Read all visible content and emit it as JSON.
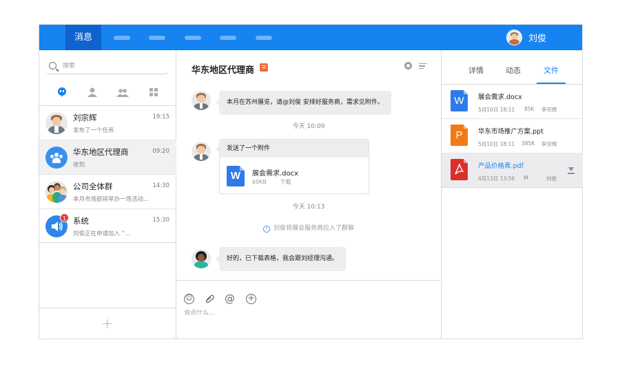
{
  "topbar": {
    "active_tab": "消息",
    "user_name": "刘俊",
    "bg_color": "#1783f0"
  },
  "sidebar": {
    "search_placeholder": "搜索",
    "filters": [
      "chat-icon",
      "person-icon",
      "group-icon",
      "apps-icon"
    ],
    "conversations": [
      {
        "title": "刘宗辉",
        "time": "19:15",
        "preview": "发布了一个任务"
      },
      {
        "title": "华东地区代理商",
        "time": "09:20",
        "preview": "收到"
      },
      {
        "title": "公司全体群",
        "time": "14:30",
        "preview": "本月市场部将举办一场活动..."
      },
      {
        "title": "系统",
        "time": "15:30",
        "preview": "刘俊正在申请加入 “...",
        "badge": "1"
      }
    ]
  },
  "chat": {
    "title": "华东地区代理商",
    "messages": [
      {
        "text": "本月在苏州展览，请@刘俊 安排好服务商，需求见附件。"
      },
      {
        "timestamp": "今天 10:09"
      },
      {
        "text": "发送了一个附件",
        "file_name": "展会需求.docx",
        "file_size": "60KB",
        "action": "下载"
      },
      {
        "timestamp": "今天 10:13"
      },
      {
        "system": "刘俊将展会服务商拉入了群聊"
      },
      {
        "text": "好的，已下载表格，我会跟刘经理沟通。"
      }
    ],
    "composer_placeholder": "说点什么..."
  },
  "details": {
    "tabs": [
      "详情",
      "动态",
      "文件"
    ],
    "active_tab": "文件",
    "files": [
      {
        "name": "展会需求.docx",
        "date": "5月10日 18:11",
        "size": "85K",
        "owner": "李宗辉",
        "type_letter": "W",
        "color": "#2e7be8"
      },
      {
        "name": "华东市场推广方案.ppt",
        "date": "5月10日 18:11",
        "size": "385K",
        "owner": "李宗辉",
        "type_letter": "P",
        "color": "#f07a17"
      },
      {
        "name": "产品价格表.pdf",
        "date": "4月13日 13:56",
        "size": "M",
        "owner": "刘俊",
        "type_letter": "pdf",
        "color": "#d9302c"
      }
    ]
  }
}
